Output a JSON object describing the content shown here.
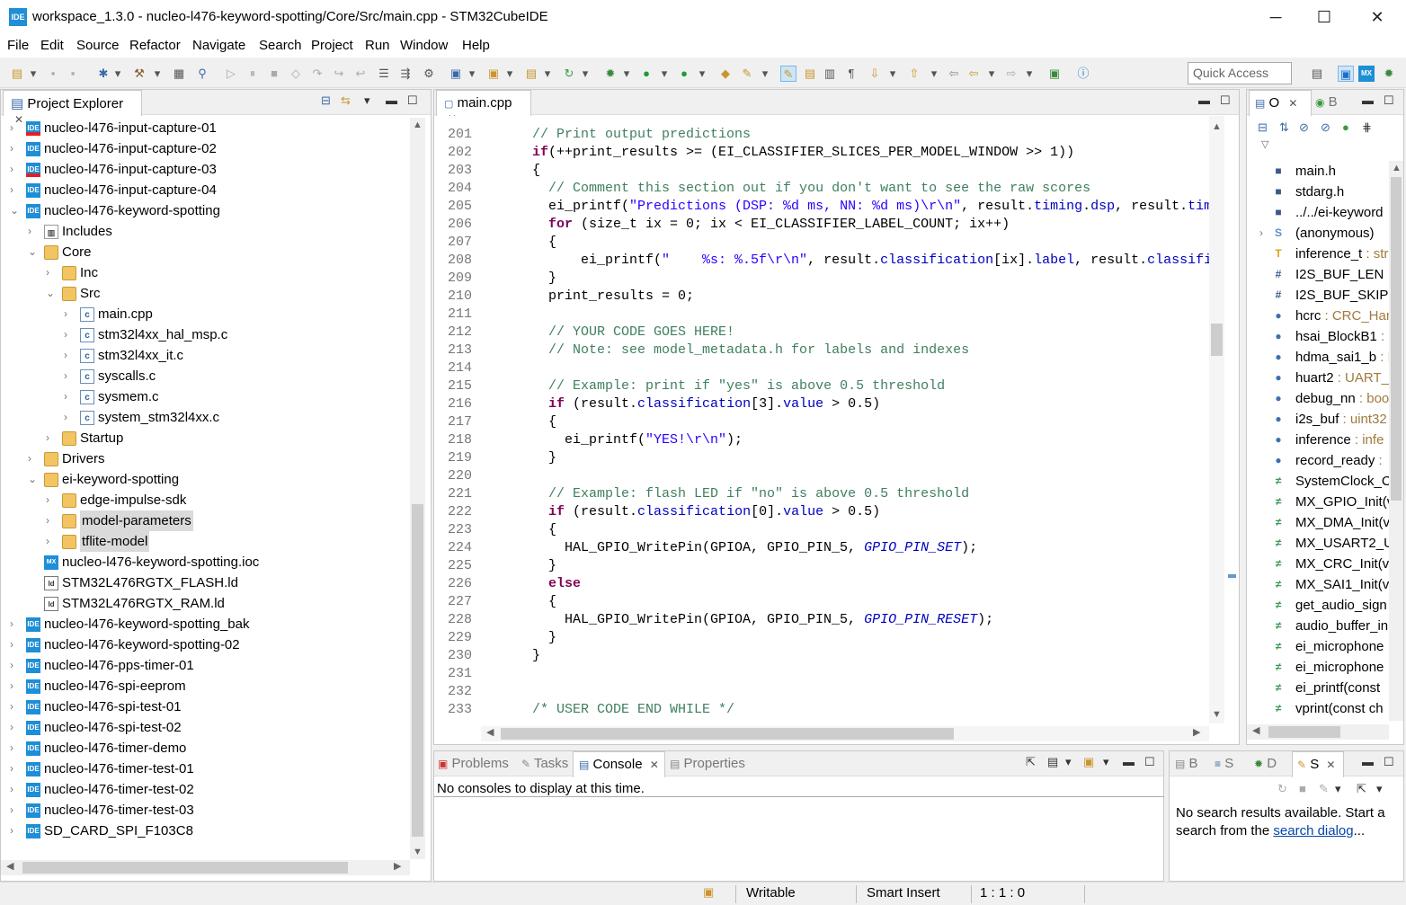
{
  "window": {
    "app_icon": "IDE",
    "title": "workspace_1.3.0 - nucleo-l476-keyword-spotting/Core/Src/main.cpp - STM32CubeIDE",
    "minimize": "─",
    "maximize": "☐",
    "close": "✕"
  },
  "menu": [
    "File",
    "Edit",
    "Source",
    "Refactor",
    "Navigate",
    "Search",
    "Project",
    "Run",
    "Window",
    "Help"
  ],
  "toolbar": {
    "quick_access_placeholder": "Quick Access"
  },
  "project_explorer": {
    "title": "Project Explorer",
    "items": [
      {
        "label": "nucleo-l476-input-capture-01",
        "icon": "ide-project-error-icon",
        "level": 0,
        "expanded": false
      },
      {
        "label": "nucleo-l476-input-capture-02",
        "icon": "ide-project-icon",
        "level": 0,
        "expanded": false
      },
      {
        "label": "nucleo-l476-input-capture-03",
        "icon": "ide-project-error-icon",
        "level": 0,
        "expanded": false
      },
      {
        "label": "nucleo-l476-input-capture-04",
        "icon": "ide-project-icon",
        "level": 0,
        "expanded": false
      },
      {
        "label": "nucleo-l476-keyword-spotting",
        "icon": "ide-project-icon",
        "level": 0,
        "expanded": true
      },
      {
        "label": "Includes",
        "icon": "includes-icon",
        "level": 1,
        "expanded": false
      },
      {
        "label": "Core",
        "icon": "source-folder-icon",
        "level": 1,
        "expanded": true
      },
      {
        "label": "Inc",
        "icon": "folder-icon",
        "level": 2,
        "expanded": false
      },
      {
        "label": "Src",
        "icon": "folder-icon",
        "level": 2,
        "expanded": true
      },
      {
        "label": "main.cpp",
        "icon": "cpp-file-icon",
        "level": 3,
        "expanded": false
      },
      {
        "label": "stm32l4xx_hal_msp.c",
        "icon": "c-file-icon",
        "level": 3,
        "expanded": false
      },
      {
        "label": "stm32l4xx_it.c",
        "icon": "c-file-icon",
        "level": 3,
        "expanded": false
      },
      {
        "label": "syscalls.c",
        "icon": "c-file-icon",
        "level": 3,
        "expanded": false
      },
      {
        "label": "sysmem.c",
        "icon": "c-file-icon",
        "level": 3,
        "expanded": false
      },
      {
        "label": "system_stm32l4xx.c",
        "icon": "c-file-icon",
        "level": 3,
        "expanded": false
      },
      {
        "label": "Startup",
        "icon": "folder-icon",
        "level": 2,
        "expanded": false
      },
      {
        "label": "Drivers",
        "icon": "source-folder-icon",
        "level": 1,
        "expanded": false
      },
      {
        "label": "ei-keyword-spotting",
        "icon": "source-folder-icon",
        "level": 1,
        "expanded": true
      },
      {
        "label": "edge-impulse-sdk",
        "icon": "folder-icon",
        "level": 2,
        "expanded": false
      },
      {
        "label": "model-parameters",
        "icon": "folder-icon",
        "level": 2,
        "expanded": false,
        "highlight": true
      },
      {
        "label": "tflite-model",
        "icon": "folder-icon",
        "level": 2,
        "expanded": false,
        "highlight": true
      },
      {
        "label": "nucleo-l476-keyword-spotting.ioc",
        "icon": "mx-file-icon",
        "level": 1,
        "leaf": true
      },
      {
        "label": "STM32L476RGTX_FLASH.ld",
        "icon": "ld-file-icon",
        "level": 1,
        "leaf": true
      },
      {
        "label": "STM32L476RGTX_RAM.ld",
        "icon": "ld-file-icon",
        "level": 1,
        "leaf": true
      },
      {
        "label": "nucleo-l476-keyword-spotting_bak",
        "icon": "ide-project-icon",
        "level": 0,
        "expanded": false
      },
      {
        "label": "nucleo-l476-keyword-spotting-02",
        "icon": "ide-project-icon",
        "level": 0,
        "expanded": false
      },
      {
        "label": "nucleo-l476-pps-timer-01",
        "icon": "ide-project-icon",
        "level": 0,
        "expanded": false
      },
      {
        "label": "nucleo-l476-spi-eeprom",
        "icon": "ide-project-icon",
        "level": 0,
        "expanded": false
      },
      {
        "label": "nucleo-l476-spi-test-01",
        "icon": "ide-project-icon",
        "level": 0,
        "expanded": false
      },
      {
        "label": "nucleo-l476-spi-test-02",
        "icon": "ide-project-icon",
        "level": 0,
        "expanded": false
      },
      {
        "label": "nucleo-l476-timer-demo",
        "icon": "ide-project-icon",
        "level": 0,
        "expanded": false
      },
      {
        "label": "nucleo-l476-timer-test-01",
        "icon": "ide-project-icon",
        "level": 0,
        "expanded": false
      },
      {
        "label": "nucleo-l476-timer-test-02",
        "icon": "ide-project-icon",
        "level": 0,
        "expanded": false
      },
      {
        "label": "nucleo-l476-timer-test-03",
        "icon": "ide-project-icon",
        "level": 0,
        "expanded": false
      },
      {
        "label": "SD_CARD_SPI_F103C8",
        "icon": "ide-project-icon",
        "level": 0,
        "expanded": false
      }
    ]
  },
  "editor": {
    "tab": "main.cpp",
    "lines": [
      {
        "n": "201",
        "html": "  <span class=\"cm\">// Print output predictions</span>"
      },
      {
        "n": "202",
        "html": "  <span class=\"kw\">if</span>(++print_results >= (EI_CLASSIFIER_SLICES_PER_MODEL_WINDOW >> 1))"
      },
      {
        "n": "203",
        "html": "  {"
      },
      {
        "n": "204",
        "html": "    <span class=\"cm\">// Comment this section out if you don't want to see the raw scores</span>"
      },
      {
        "n": "205",
        "html": "    ei_printf(<span class=\"str\">\"Predictions (DSP: %d ms, NN: %d ms)\\r\\n\"</span>, result.<span class=\"fld\">timing</span>.<span class=\"fld\">dsp</span>, result.<span class=\"fld\">timin</span>"
      },
      {
        "n": "206",
        "html": "    <span class=\"kw\">for</span> (size_t ix = 0; ix < EI_CLASSIFIER_LABEL_COUNT; ix++)"
      },
      {
        "n": "207",
        "html": "    {"
      },
      {
        "n": "208",
        "html": "        ei_printf(<span class=\"str\">\"    %s: %.5f\\r\\n\"</span>, result.<span class=\"fld\">classification</span>[ix].<span class=\"fld\">label</span>, result.<span class=\"fld\">classifica</span>"
      },
      {
        "n": "209",
        "html": "    }"
      },
      {
        "n": "210",
        "html": "    print_results = 0;"
      },
      {
        "n": "211",
        "html": ""
      },
      {
        "n": "212",
        "html": "    <span class=\"cm\">// YOUR CODE GOES HERE!</span>"
      },
      {
        "n": "213",
        "html": "    <span class=\"cm\">// Note: see model_metadata.h for labels and indexes</span>"
      },
      {
        "n": "214",
        "html": ""
      },
      {
        "n": "215",
        "html": "    <span class=\"cm\">// Example: print if \"yes\" is above 0.5 threshold</span>"
      },
      {
        "n": "216",
        "html": "    <span class=\"kw\">if</span> (result.<span class=\"fld\">classification</span>[3].<span class=\"fld\">value</span> > 0.5)"
      },
      {
        "n": "217",
        "html": "    {"
      },
      {
        "n": "218",
        "html": "      ei_printf(<span class=\"str\">\"YES!\\r\\n\"</span>);"
      },
      {
        "n": "219",
        "html": "    }"
      },
      {
        "n": "220",
        "html": ""
      },
      {
        "n": "221",
        "html": "    <span class=\"cm\">// Example: flash LED if \"no\" is above 0.5 threshold</span>"
      },
      {
        "n": "222",
        "html": "    <span class=\"kw\">if</span> (result.<span class=\"fld\">classification</span>[0].<span class=\"fld\">value</span> > 0.5)"
      },
      {
        "n": "223",
        "html": "    {"
      },
      {
        "n": "224",
        "html": "      HAL_GPIO_WritePin(GPIOA, GPIO_PIN_5, <span class=\"mac\">GPIO_PIN_SET</span>);"
      },
      {
        "n": "225",
        "html": "    }"
      },
      {
        "n": "226",
        "html": "    <span class=\"kw\">else</span>"
      },
      {
        "n": "227",
        "html": "    {"
      },
      {
        "n": "228",
        "html": "      HAL_GPIO_WritePin(GPIOA, GPIO_PIN_5, <span class=\"mac\">GPIO_PIN_RESET</span>);"
      },
      {
        "n": "229",
        "html": "    }"
      },
      {
        "n": "230",
        "html": "  }"
      },
      {
        "n": "231",
        "html": ""
      },
      {
        "n": "232",
        "html": ""
      },
      {
        "n": "233",
        "html": "  <span class=\"cm\">/* USER CODE END WHILE */</span>"
      }
    ]
  },
  "outline": {
    "tabs": [
      "O",
      "B"
    ],
    "items": [
      {
        "name": "main.h",
        "type": "",
        "icon": "include-icon",
        "sym": "■",
        "color": "#3a5a8a"
      },
      {
        "name": "stdarg.h",
        "type": "",
        "icon": "include-icon",
        "sym": "■",
        "color": "#3a5a8a"
      },
      {
        "name": "../../ei-keyword",
        "type": "",
        "icon": "include-icon",
        "sym": "■",
        "color": "#3a5a8a"
      },
      {
        "name": "(anonymous)",
        "type": "",
        "icon": "namespace-icon",
        "sym": "S",
        "color": "#5b8fc9",
        "expandable": true
      },
      {
        "name": "inference_t",
        "type": " : str",
        "icon": "typedef-icon",
        "sym": "T",
        "color": "#e0a020"
      },
      {
        "name": "I2S_BUF_LEN",
        "type": "",
        "icon": "macro-icon",
        "sym": "#",
        "color": "#3a5a8a"
      },
      {
        "name": "I2S_BUF_SKIP",
        "type": "",
        "icon": "macro-icon",
        "sym": "#",
        "color": "#3a5a8a"
      },
      {
        "name": "hcrc",
        "type": " : CRC_Han",
        "icon": "variable-icon",
        "sym": "●",
        "color": "#3f6fb0"
      },
      {
        "name": "hsai_BlockB1",
        "type": " : S",
        "icon": "variable-icon",
        "sym": "●",
        "color": "#3f6fb0"
      },
      {
        "name": "hdma_sai1_b",
        "type": " : D",
        "icon": "variable-icon",
        "sym": "●",
        "color": "#3f6fb0"
      },
      {
        "name": "huart2",
        "type": " : UART_I",
        "icon": "variable-icon",
        "sym": "●",
        "color": "#3f6fb0"
      },
      {
        "name": "debug_nn",
        "type": " : boo",
        "icon": "static-variable-icon",
        "sym": "●",
        "color": "#3f6fb0"
      },
      {
        "name": "i2s_buf",
        "type": " : uint32",
        "icon": "static-variable-icon",
        "sym": "●",
        "color": "#3f6fb0"
      },
      {
        "name": "inference",
        "type": " : infe",
        "icon": "static-variable-icon",
        "sym": "●",
        "color": "#3f6fb0"
      },
      {
        "name": "record_ready",
        "type": " : ",
        "icon": "static-variable-icon",
        "sym": "●",
        "color": "#3f6fb0"
      },
      {
        "name": "SystemClock_C",
        "type": "",
        "icon": "function-icon",
        "sym": "≠",
        "color": "#3a9a5a"
      },
      {
        "name": "MX_GPIO_Init(v",
        "type": "",
        "icon": "static-function-icon",
        "sym": "≠",
        "color": "#3a9a5a"
      },
      {
        "name": "MX_DMA_Init(v",
        "type": "",
        "icon": "static-function-icon",
        "sym": "≠",
        "color": "#3a9a5a"
      },
      {
        "name": "MX_USART2_U",
        "type": "",
        "icon": "static-function-icon",
        "sym": "≠",
        "color": "#3a9a5a"
      },
      {
        "name": "MX_CRC_Init(vo",
        "type": "",
        "icon": "static-function-icon",
        "sym": "≠",
        "color": "#3a9a5a"
      },
      {
        "name": "MX_SAI1_Init(v",
        "type": "",
        "icon": "static-function-icon",
        "sym": "≠",
        "color": "#3a9a5a"
      },
      {
        "name": "get_audio_sign",
        "type": "",
        "icon": "static-function-icon",
        "sym": "≠",
        "color": "#3a9a5a"
      },
      {
        "name": "audio_buffer_in",
        "type": "",
        "icon": "static-function-icon",
        "sym": "≠",
        "color": "#3a9a5a"
      },
      {
        "name": "ei_microphone",
        "type": "",
        "icon": "function-icon",
        "sym": "≠",
        "color": "#3a9a5a"
      },
      {
        "name": "ei_microphone",
        "type": "",
        "icon": "function-icon",
        "sym": "≠",
        "color": "#3a9a5a"
      },
      {
        "name": "ei_printf(const",
        "type": "",
        "icon": "function-icon",
        "sym": "≠",
        "color": "#3a9a5a"
      },
      {
        "name": "vprint(const ch",
        "type": "",
        "icon": "function-icon",
        "sym": "≠",
        "color": "#3a9a5a"
      }
    ]
  },
  "console_panel": {
    "tabs": {
      "problems": "Problems",
      "tasks": "Tasks",
      "console": "Console",
      "properties": "Properties"
    },
    "message": "No consoles to display at this time."
  },
  "search_panel": {
    "tabs": {
      "b": "B",
      "s1": "S",
      "d": "D",
      "s2": "S"
    },
    "message_prefix": "No search results available. Start a search from the ",
    "link": "search dialog",
    "message_suffix": "..."
  },
  "status": {
    "writable": "Writable",
    "insert_mode": "Smart Insert",
    "position": "1 : 1 : 0"
  }
}
